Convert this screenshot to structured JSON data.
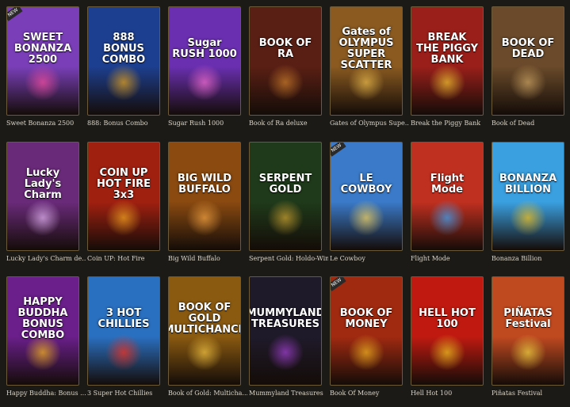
{
  "games": [
    {
      "title": "Sweet Bonanza 2500",
      "logo": "SWEET BONANZA 2500",
      "bg": "#7a3fb8",
      "accent": "#f04ca0",
      "new": "NEW"
    },
    {
      "title": "888: Bonus Combo",
      "logo": "888 BONUS COMBO",
      "bg": "#1d3f8f",
      "accent": "#e0a020"
    },
    {
      "title": "Sugar Rush 1000",
      "logo": "Sugar RUSH 1000",
      "bg": "#6a2fb0",
      "accent": "#f06bd0"
    },
    {
      "title": "Book of Ra deluxe",
      "logo": "BOOK OF RA",
      "bg": "#5a1f14",
      "accent": "#c87a2a"
    },
    {
      "title": "Gates of Olympus Supe...",
      "logo": "Gates of OLYMPUS SUPER SCATTER",
      "bg": "#8a5a20",
      "accent": "#e8b84a"
    },
    {
      "title": "Break the Piggy Bank",
      "logo": "BREAK THE PIGGY BANK",
      "bg": "#9a1f1a",
      "accent": "#f0c030"
    },
    {
      "title": "Book of Dead",
      "logo": "BOOK OF DEAD",
      "bg": "#6a4a2a",
      "accent": "#c8a060"
    },
    {
      "title": "Lucky Lady's Charm de...",
      "logo": "Lucky Lady's Charm",
      "bg": "#6a2a7a",
      "accent": "#e0b0f0"
    },
    {
      "title": "Coin UP: Hot Fire",
      "logo": "COIN UP HOT FIRE 3x3",
      "bg": "#a02010",
      "accent": "#f0a020"
    },
    {
      "title": "Big Wild Buffalo",
      "logo": "BIG WILD BUFFALO",
      "bg": "#8a4a10",
      "accent": "#f0a040"
    },
    {
      "title": "Serpent Gold: Holdo-Win",
      "logo": "SERPENT GOLD",
      "bg": "#1f3a1a",
      "accent": "#c8a030"
    },
    {
      "title": "Le Cowboy",
      "logo": "LE COWBOY",
      "bg": "#3a7ac8",
      "accent": "#f0d060",
      "new": "NEW"
    },
    {
      "title": "Flight Mode",
      "logo": "Flight Mode",
      "bg": "#c03020",
      "accent": "#40a0f0"
    },
    {
      "title": "Bonanza Billion",
      "logo": "BONANZA BILLION",
      "bg": "#3aa0e0",
      "accent": "#f0c020"
    },
    {
      "title": "Happy Buddha: Bonus ...",
      "logo": "HAPPY BUDDHA BONUS COMBO",
      "bg": "#6a1f8a",
      "accent": "#f0b020"
    },
    {
      "title": "3 Super Hot Chillies",
      "logo": "3 HOT CHILLIES",
      "bg": "#2a70c0",
      "accent": "#f03020"
    },
    {
      "title": "Book of Gold: Multicha...",
      "logo": "BOOK OF GOLD MULTICHANCE",
      "bg": "#8a5a10",
      "accent": "#f0c040"
    },
    {
      "title": "Mummyland Treasures",
      "logo": "MUMMYLAND TREASURES",
      "bg": "#1f1a2a",
      "accent": "#a040d0"
    },
    {
      "title": "Book Of Money",
      "logo": "BOOK OF MONEY",
      "bg": "#a02a10",
      "accent": "#f0b020",
      "new": "NEW"
    },
    {
      "title": "Hell Hot 100",
      "logo": "HELL HOT 100",
      "bg": "#c01a10",
      "accent": "#f0c020"
    },
    {
      "title": "Piñatas Festival",
      "logo": "PIÑATAS Festival",
      "bg": "#c04a20",
      "accent": "#f0d040"
    }
  ]
}
